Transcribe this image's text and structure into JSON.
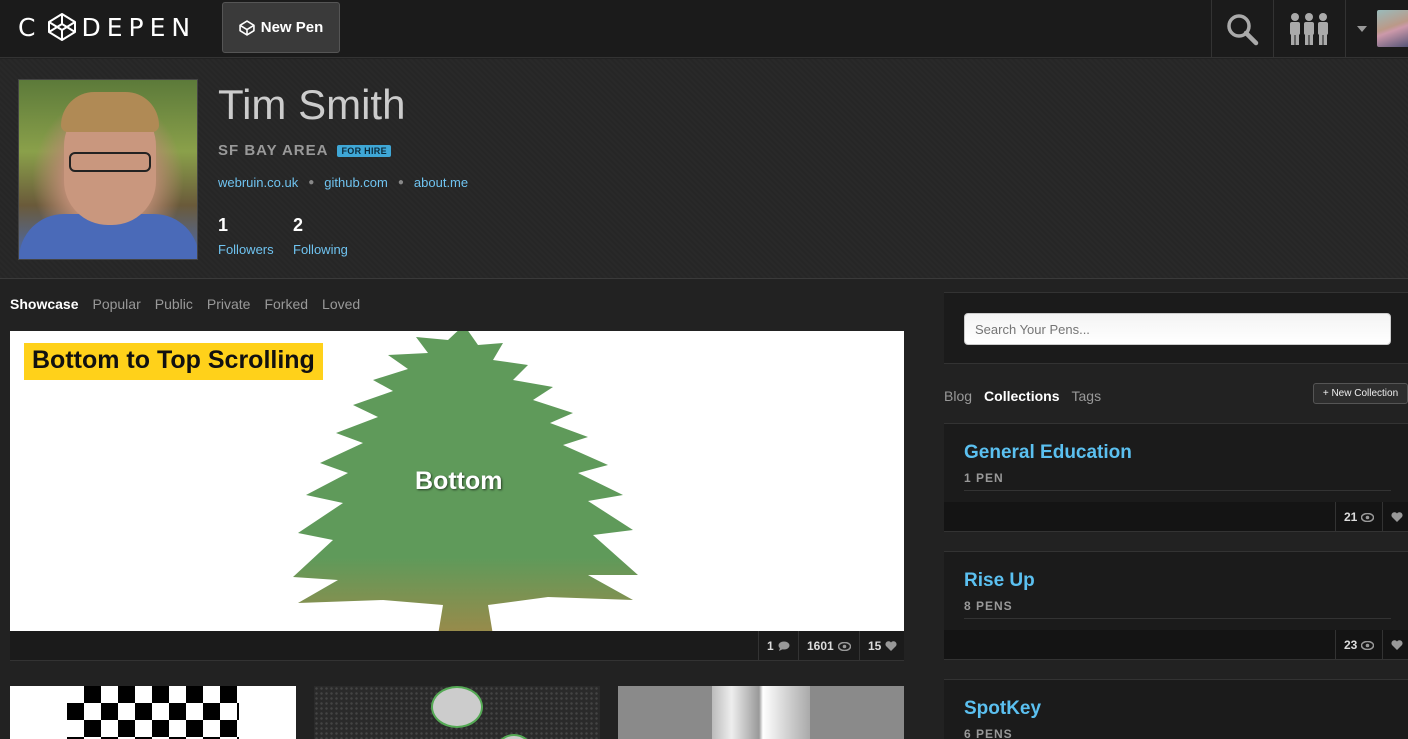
{
  "topbar": {
    "logo_text_left": "C",
    "logo_text_right": "DEPEN",
    "new_pen_label": "New Pen"
  },
  "profile": {
    "name": "Tim Smith",
    "location": "SF BAY AREA",
    "hire_badge": "FOR HIRE",
    "links": [
      "webruin.co.uk",
      "github.com",
      "about.me"
    ],
    "followers": {
      "count": "1",
      "label": "Followers"
    },
    "following": {
      "count": "2",
      "label": "Following"
    }
  },
  "tabs": [
    "Showcase",
    "Popular",
    "Public",
    "Private",
    "Forked",
    "Loved"
  ],
  "active_tab": "Showcase",
  "featured_pen": {
    "title": "Bottom to Top Scrolling",
    "inner_label": "Bottom",
    "comments": "1",
    "views": "1601",
    "loves": "15"
  },
  "sidebar": {
    "search_placeholder": "Search Your Pens...",
    "tabs": [
      "Blog",
      "Collections",
      "Tags"
    ],
    "active_tab": "Collections",
    "new_collection_label": "+ New Collection",
    "collections": [
      {
        "title": "General Education",
        "count": "1 PEN",
        "views": "21"
      },
      {
        "title": "Rise Up",
        "count": "8 PENS",
        "views": "23"
      },
      {
        "title": "SpotKey",
        "count": "6 PENS",
        "views": ""
      }
    ]
  },
  "colors": {
    "accent_link": "#6fc3f0",
    "hire_badge": "#3fa7d6",
    "title_highlight": "#ffd11a",
    "tree_green": "#5f9a5a"
  }
}
